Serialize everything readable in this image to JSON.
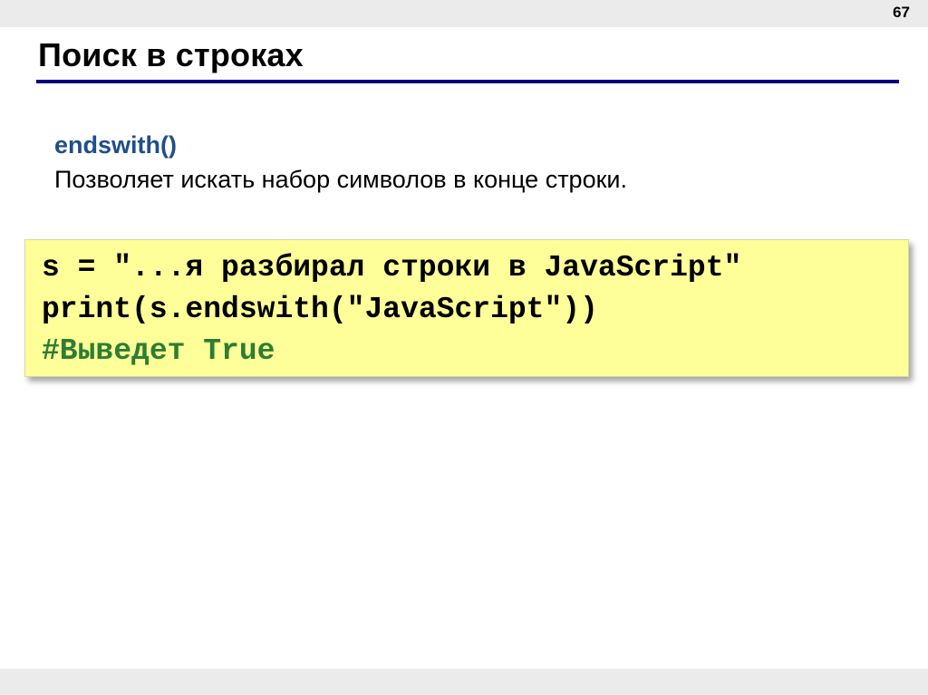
{
  "slide": {
    "number": "67",
    "title": "Поиск в строках"
  },
  "content": {
    "method_name": "endswith()",
    "description": "Позволяет искать набор символов в конце строки."
  },
  "code": {
    "lines": [
      "s = \"...я разбирал строки в JavaScript\"",
      "print(s.endswith(\"JavaScript\"))",
      "#Выведет True"
    ]
  },
  "colors": {
    "title_rule": "#000080",
    "method_name": "#1f4e8c",
    "code_background": "#ffff99",
    "comment": "#2e7d32"
  }
}
